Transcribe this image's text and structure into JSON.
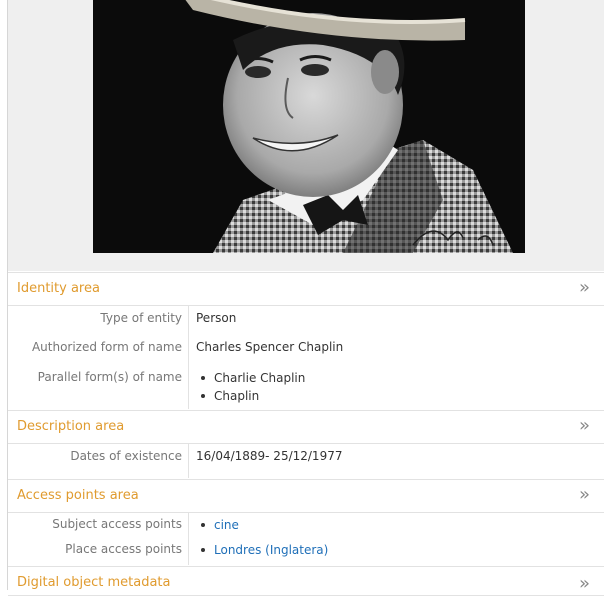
{
  "identity": {
    "title": "Identity area",
    "type_label": "Type of entity",
    "type_value": "Person",
    "auth_label": "Authorized form of name",
    "auth_value": "Charles Spencer Chaplin",
    "parallel_label": "Parallel form(s) of name",
    "parallel_values": [
      "Charlie Chaplin",
      "Chaplin"
    ]
  },
  "description": {
    "title": "Description area",
    "dates_label": "Dates of existence",
    "dates_value": "16/04/1889- 25/12/1977"
  },
  "access": {
    "title": "Access points area",
    "subject_label": "Subject access points",
    "subject_values": [
      "cine"
    ],
    "place_label": "Place access points",
    "place_values": [
      "Londres (Inglatera)"
    ]
  },
  "digital": {
    "title": "Digital object metadata"
  },
  "chevron": "»",
  "colors": {
    "section_title": "#e09b2f",
    "link": "#1f6fb8"
  }
}
